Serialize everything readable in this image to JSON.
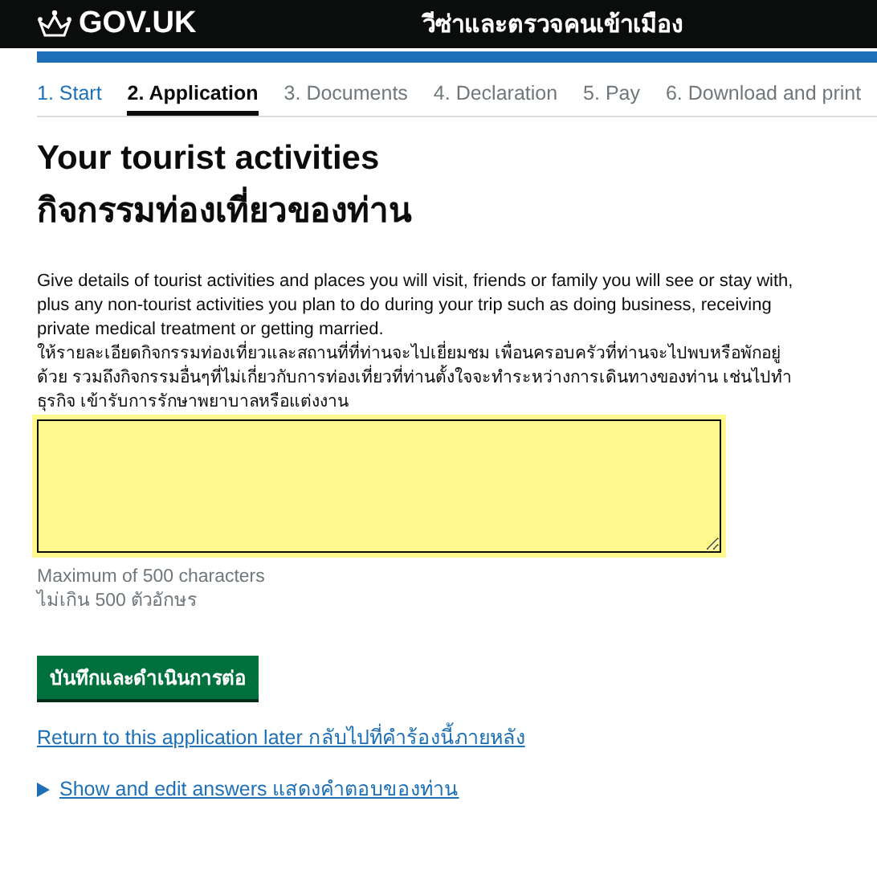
{
  "header": {
    "logo": "GOV.UK",
    "service": "วีซ่าและตรวจคนเข้าเมือง"
  },
  "steps": [
    {
      "label": "1. Start",
      "completed": true,
      "selected": false
    },
    {
      "label": "2. Application",
      "completed": false,
      "selected": true
    },
    {
      "label": "3. Documents",
      "completed": false,
      "selected": false
    },
    {
      "label": "4. Declaration",
      "completed": false,
      "selected": false
    },
    {
      "label": "5. Pay",
      "completed": false,
      "selected": false
    },
    {
      "label": "6. Download and print",
      "completed": false,
      "selected": false
    }
  ],
  "heading": "Your tourist activities",
  "heading_th": "กิจกรรมท่องเที่ยวของท่าน",
  "description": "Give details of tourist activities and places you will visit, friends or family you will see or stay with, plus any non-tourist activities you plan to do during your trip such as doing business, receiving private medical treatment or getting married.",
  "description_th": "ให้รายละเอียดกิจกรรมท่องเที่ยวและสถานที่ที่ท่านจะไปเยี่ยมชม เพื่อนครอบครัวที่ท่านจะไปพบหรือพักอยู่ด้วย รวมถึงกิจกรรมอื่นๆที่ไม่เกี่ยวกับการท่องเที่ยวที่ท่านตั้งใจจะทำระหว่างการเดินทางของท่าน เช่นไปทำธุรกิจ เข้ารับการรักษาพยาบาลหรือแต่งงาน",
  "answer": {
    "focused": true
  },
  "hint": "Maximum of 500 characters",
  "hint_th": "ไม่เกิน 500 ตัวอักษร",
  "submit_button": "บันทึกและดำเนินการต่อ",
  "return_link": "Return to this application later กลับไปที่คำร้องนี้ภายหลัง",
  "details": {
    "label": "Show and edit answers แสดงคำตอบของท่าน",
    "expanded": false
  }
}
